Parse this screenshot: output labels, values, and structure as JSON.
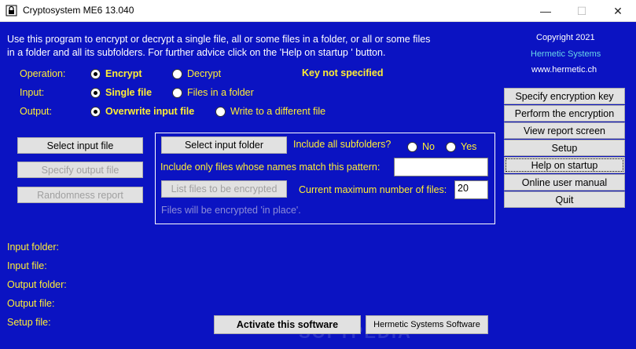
{
  "window": {
    "title": "Cryptosystem ME6 13.040",
    "icon": "lock-app-icon",
    "minimize_glyph": "—",
    "maximize_glyph": "☐",
    "close_glyph": "✕"
  },
  "intro": {
    "line1": "Use this program to encrypt or decrypt a single file, all or some files in a folder, or all or some files",
    "line2": "in a folder and all its subfolders.  For further advice click on the 'Help on startup ' button."
  },
  "copyright": {
    "line1": "Copyright 2021",
    "line2": "Hermetic Systems",
    "line3": "www.hermetic.ch"
  },
  "operation": {
    "label": "Operation:",
    "encrypt": "Encrypt",
    "decrypt": "Decrypt",
    "selected": "encrypt"
  },
  "key_status": "Key not specified",
  "input": {
    "label": "Input:",
    "single": "Single file",
    "folder": "Files in a folder",
    "selected": "single"
  },
  "output": {
    "label": "Output:",
    "overwrite": "Overwrite input file",
    "different": "Write to a different file",
    "selected": "overwrite"
  },
  "left_buttons": {
    "select_input_file": "Select input file",
    "specify_output_file": "Specify output file",
    "randomness_report": "Randomness report"
  },
  "folder_group": {
    "select_input_folder": "Select input folder",
    "include_subfolders": "Include all subfolders?",
    "no": "No",
    "yes": "Yes",
    "pattern_label": "Include only files whose names match this pattern:",
    "pattern_value": "",
    "list_files": "List files to be encrypted",
    "max_files_label": "Current maximum number of files:",
    "max_files_value": "20",
    "note": "Files will be encrypted 'in place'."
  },
  "right_buttons": {
    "specify_key": "Specify encryption key",
    "perform": "Perform the encryption",
    "view_report": "View report screen",
    "setup": "Setup",
    "help": "Help on startup",
    "manual": "Online user manual",
    "quit": "Quit"
  },
  "info_fields": {
    "input_folder": "Input folder:",
    "input_file": "Input file:",
    "output_folder": "Output folder:",
    "output_file": "Output file:",
    "setup_file": "Setup file:"
  },
  "bottom_buttons": {
    "activate": "Activate this software",
    "hermetic": "Hermetic Systems Software"
  },
  "watermark": "SOFTPEDIA",
  "colors": {
    "background": "#0b13c2",
    "label_yellow": "#ffee33",
    "link_cyan": "#68d6e8",
    "disabled_gray": "#8c8cd8"
  }
}
